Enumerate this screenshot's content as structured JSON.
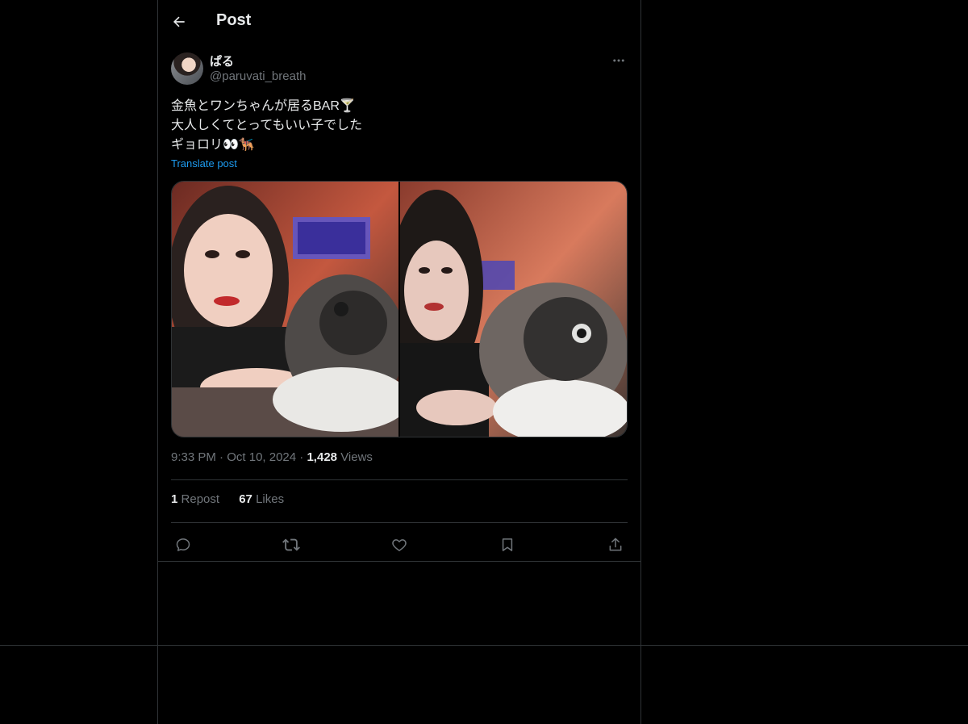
{
  "header": {
    "title": "Post",
    "back_icon": "arrow-left-icon"
  },
  "post": {
    "author": {
      "display_name": "ぱる",
      "handle": "@paruvati_breath"
    },
    "text": "金魚とワンちゃんが居るBAR🍸\n大人しくてとってもいい子でした\nギョロリ👀🐕‍🦺",
    "translate_label": "Translate post",
    "media": [
      {
        "alt": "selfie with a French bulldog at a bar (1)"
      },
      {
        "alt": "selfie with a French bulldog at a bar (2)"
      }
    ],
    "time": "9:33 PM",
    "date": "Oct 10, 2024",
    "views_count": "1,428",
    "views_label": "Views",
    "reposts_count": "1",
    "reposts_label": "Repost",
    "likes_count": "67",
    "likes_label": "Likes"
  },
  "actions": {
    "reply_icon": "reply-icon",
    "repost_icon": "repost-icon",
    "like_icon": "like-icon",
    "bookmark_icon": "bookmark-icon",
    "share_icon": "share-icon"
  },
  "colors": {
    "background": "#000000",
    "text": "#e7e9ea",
    "muted": "#71767b",
    "border": "#2f3336",
    "link": "#1d9bf0"
  }
}
